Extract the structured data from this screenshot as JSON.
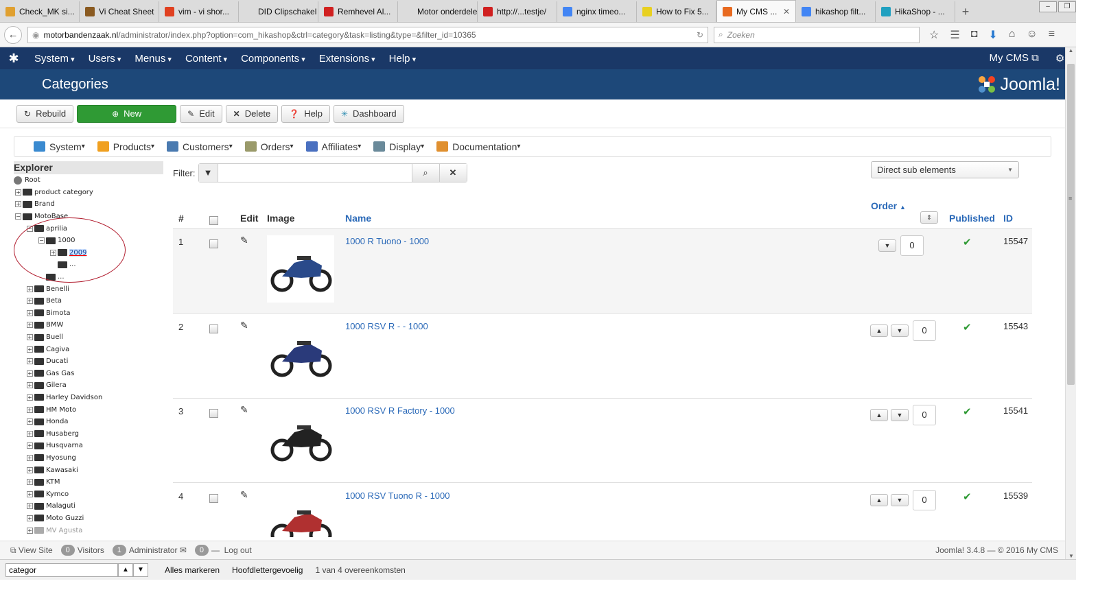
{
  "browser": {
    "tabs": [
      {
        "label": "Check_MK si...",
        "icon": "checkmk-icon",
        "color": "#e0a030"
      },
      {
        "label": "Vi Cheat Sheet",
        "icon": "vi-icon",
        "color": "#8a5a20"
      },
      {
        "label": "vim - vi shor...",
        "icon": "ask-icon",
        "color": "#e04020"
      },
      {
        "label": "DID Clipschakel ...",
        "icon": "blank-icon",
        "color": "#dcdcdc"
      },
      {
        "label": "Remhevel Al...",
        "icon": "pause-icon",
        "color": "#d02020"
      },
      {
        "label": "Motor onderdele...",
        "icon": "blank-icon",
        "color": "#dcdcdc"
      },
      {
        "label": "http://...testje/",
        "icon": "pause-icon",
        "color": "#d02020"
      },
      {
        "label": "nginx timeo...",
        "icon": "google-icon",
        "color": "#4285f4"
      },
      {
        "label": "How to Fix 5...",
        "icon": "fix-icon",
        "color": "#e8d020"
      },
      {
        "label": "My CMS ...",
        "icon": "joomla-icon",
        "color": "#e86a20",
        "active": true,
        "close": "✕"
      },
      {
        "label": "hikashop filt...",
        "icon": "google-icon",
        "color": "#4285f4"
      },
      {
        "label": "HikaShop - ...",
        "icon": "hikashop-icon",
        "color": "#20a0c0"
      }
    ],
    "new_tab": "+",
    "url_domain": "motorbandenzaak.nl",
    "url_path": "/administrator/index.php?option=com_hikashop&ctrl=category&task=listing&type=&filter_id=10365",
    "search_placeholder": "Zoeken"
  },
  "joomla": {
    "menu": [
      "System",
      "Users",
      "Menus",
      "Content",
      "Components",
      "Extensions",
      "Help"
    ],
    "site_link": "My CMS",
    "page_title": "Categories",
    "brand": "Joomla!"
  },
  "toolbar": {
    "rebuild": "Rebuild",
    "new": "New",
    "edit": "Edit",
    "delete": "Delete",
    "help": "Help",
    "dashboard": "Dashboard"
  },
  "hikamenu": [
    {
      "label": "System",
      "color": "#3a8ad0"
    },
    {
      "label": "Products",
      "color": "#f0a020"
    },
    {
      "label": "Customers",
      "color": "#4a7ab0"
    },
    {
      "label": "Orders",
      "color": "#9a9a6a"
    },
    {
      "label": "Affiliates",
      "color": "#4a70c0"
    },
    {
      "label": "Display",
      "color": "#6a8a9a"
    },
    {
      "label": "Documentation",
      "color": "#e09030"
    }
  ],
  "explorer": {
    "title": "Explorer",
    "root": "Root",
    "nodes": [
      {
        "label": "product category",
        "indent": 0
      },
      {
        "label": "Brand",
        "indent": 0
      },
      {
        "label": "MotoBase",
        "indent": 0,
        "open": true
      },
      {
        "label": "aprilia",
        "indent": 1,
        "open": true
      },
      {
        "label": "1000",
        "indent": 2,
        "open": true
      },
      {
        "label": "2009",
        "indent": 3,
        "selected": true
      },
      {
        "label": "...",
        "indent": 3,
        "leaf": true
      },
      {
        "label": "...",
        "indent": 2,
        "leaf": true
      },
      {
        "label": "Benelli",
        "indent": 1
      },
      {
        "label": "Beta",
        "indent": 1
      },
      {
        "label": "Bimota",
        "indent": 1
      },
      {
        "label": "BMW",
        "indent": 1
      },
      {
        "label": "Buell",
        "indent": 1
      },
      {
        "label": "Cagiva",
        "indent": 1
      },
      {
        "label": "Ducati",
        "indent": 1
      },
      {
        "label": "Gas Gas",
        "indent": 1
      },
      {
        "label": "Gilera",
        "indent": 1
      },
      {
        "label": "Harley Davidson",
        "indent": 1
      },
      {
        "label": "HM Moto",
        "indent": 1
      },
      {
        "label": "Honda",
        "indent": 1
      },
      {
        "label": "Husaberg",
        "indent": 1
      },
      {
        "label": "Husqvarna",
        "indent": 1
      },
      {
        "label": "Hyosung",
        "indent": 1
      },
      {
        "label": "Kawasaki",
        "indent": 1
      },
      {
        "label": "KTM",
        "indent": 1
      },
      {
        "label": "Kymco",
        "indent": 1
      },
      {
        "label": "Malaguti",
        "indent": 1
      },
      {
        "label": "Moto Guzzi",
        "indent": 1
      },
      {
        "label": "MV Agusta",
        "indent": 1,
        "dim": true
      }
    ]
  },
  "filter": {
    "label": "Filter:",
    "value": ""
  },
  "direct_select": "Direct sub elements",
  "table": {
    "headers": {
      "num": "#",
      "edit": "Edit",
      "image": "Image",
      "name": "Name",
      "order": "Order",
      "published": "Published",
      "id": "ID"
    },
    "rows": [
      {
        "num": "1",
        "name": "1000 R Tuono - 1000",
        "order": "0",
        "id": "15547",
        "up": false,
        "bike": "#2a4a8a"
      },
      {
        "num": "2",
        "name": "1000 RSV R - - 1000",
        "order": "0",
        "id": "15543",
        "up": true,
        "bike": "#2a3a7a"
      },
      {
        "num": "3",
        "name": "1000 RSV R Factory - 1000",
        "order": "0",
        "id": "15541",
        "up": true,
        "bike": "#222"
      },
      {
        "num": "4",
        "name": "1000 RSV Tuono R - 1000",
        "order": "0",
        "id": "15539",
        "up": true,
        "bike": "#b03030"
      }
    ]
  },
  "status": {
    "view_site": "View Site",
    "visitors_count": "0",
    "visitors": "Visitors",
    "admin_count": "1",
    "admin": "Administrator",
    "msg_count": "0",
    "logout": "Log out",
    "copyright": "Joomla! 3.4.8 — © 2016 My CMS"
  },
  "findbar": {
    "value": "categor",
    "highlight_all": "Alles markeren",
    "match_case": "Hoofdlettergevoelig",
    "result": "1 van 4 overeenkomsten"
  }
}
